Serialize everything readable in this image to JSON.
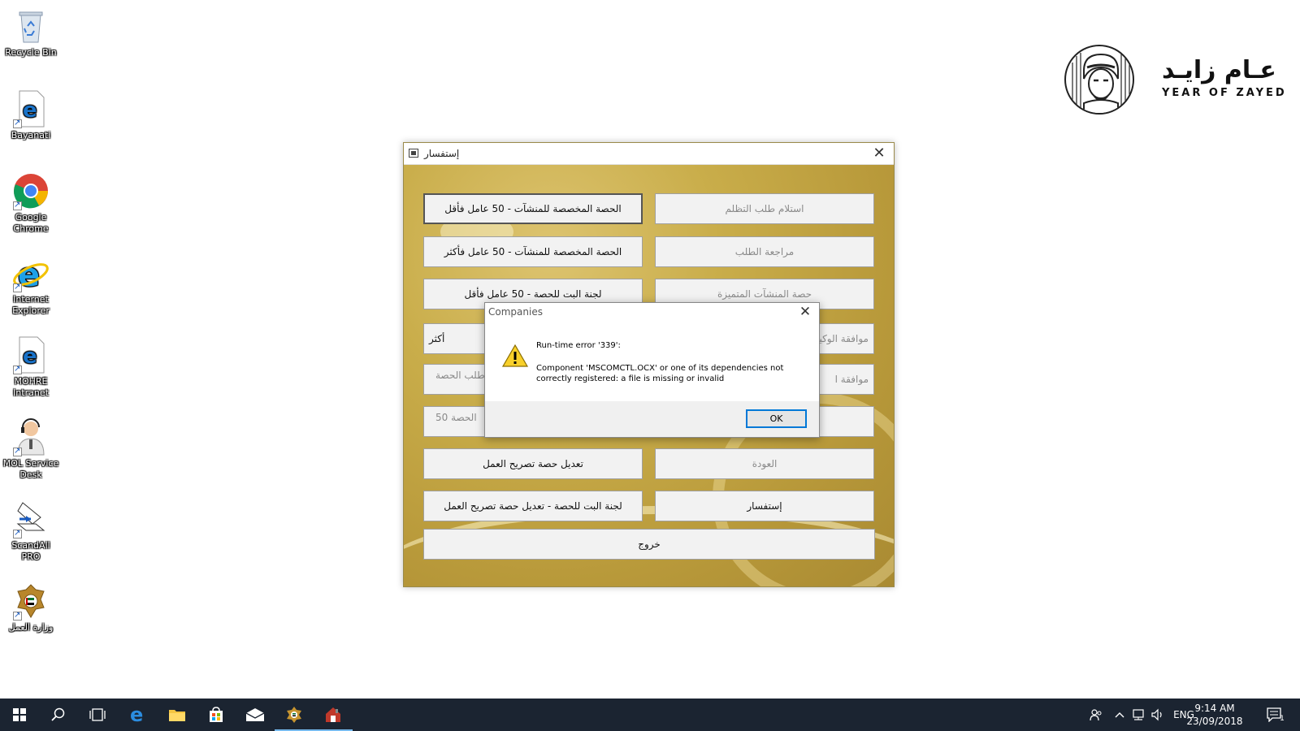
{
  "desktop": {
    "icons": [
      {
        "label": "Recycle Bin"
      },
      {
        "label": "Bayanati"
      },
      {
        "label": "Google Chrome"
      },
      {
        "label": "Internet Explorer"
      },
      {
        "label": "MOHRE Intranet"
      },
      {
        "label": "MOL Service Desk"
      },
      {
        "label": "ScandAll PRO"
      },
      {
        "label": "وزارة العمل"
      }
    ]
  },
  "logo": {
    "arabic": "عـام زايـد",
    "english": "YEAR OF ZAYED"
  },
  "window": {
    "title": "إستفسار",
    "buttons": {
      "quota_50_less": "الحصة المخصصة للمنشآت  -  50 عامل فأقل",
      "receive_complaint": "استلام طلب التظلم",
      "quota_50_more": "الحصة المخصصة للمنشآت  -  50 عامل فأكثر",
      "review_request": "مراجعة الطلب",
      "committee_50_less": "لجنة البت للحصة - 50 عامل فأقل",
      "distinguished_quota": "حصة المنشآت المتميزة",
      "row4_left_partial": "أكثر",
      "row4_right_partial": "موافقة الوكيل",
      "row5_left_partial": "طلب الحصة",
      "row5_right_partial": "موافقة ا",
      "row6_left_partial": "الحصة   50",
      "modify_work_permit_quota": "تعديل حصة تصريح العمل",
      "back": "العودة",
      "committee_modify": "لجنة البت للحصة - تعديل حصة تصريح العمل",
      "inquiry": "إستفسار",
      "exit": "خروج"
    }
  },
  "dialog": {
    "title": "Companies",
    "error_line": "Run-time error '339':",
    "message": "Component 'MSCOMCTL.OCX' or one of its dependencies not correctly registered: a file is missing or invalid",
    "ok_label": "OK"
  },
  "taskbar": {
    "language": "ENG",
    "time": "9:14 AM",
    "date": "23/09/2018",
    "notification_count": "1"
  }
}
